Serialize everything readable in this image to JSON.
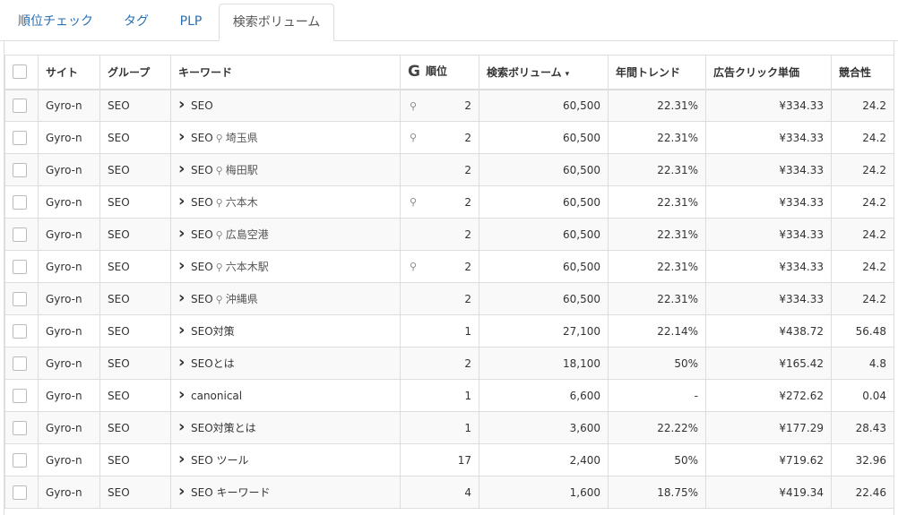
{
  "tabs": [
    {
      "label": "順位チェック",
      "active": false
    },
    {
      "label": "タグ",
      "active": false
    },
    {
      "label": "PLP",
      "active": false
    },
    {
      "label": "検索ボリューム",
      "active": true
    }
  ],
  "table": {
    "headers": {
      "site": "サイト",
      "group": "グループ",
      "keyword": "キーワード",
      "rank_icon": "G",
      "rank": "順位",
      "volume": "検索ボリューム",
      "trend": "年間トレンド",
      "cpc": "広告クリック単価",
      "competition": "競合性"
    },
    "sort_indicator": "▾",
    "rows": [
      {
        "site": "Gyro-n",
        "group": "SEO",
        "keyword": "SEO",
        "location": "",
        "rank_pin": true,
        "rank": "2",
        "volume": "60,500",
        "trend": "22.31%",
        "cpc": "¥334.33",
        "competition": "24.2"
      },
      {
        "site": "Gyro-n",
        "group": "SEO",
        "keyword": "SEO",
        "location": "埼玉県",
        "rank_pin": true,
        "rank": "2",
        "volume": "60,500",
        "trend": "22.31%",
        "cpc": "¥334.33",
        "competition": "24.2"
      },
      {
        "site": "Gyro-n",
        "group": "SEO",
        "keyword": "SEO",
        "location": "梅田駅",
        "rank_pin": false,
        "rank": "2",
        "volume": "60,500",
        "trend": "22.31%",
        "cpc": "¥334.33",
        "competition": "24.2"
      },
      {
        "site": "Gyro-n",
        "group": "SEO",
        "keyword": "SEO",
        "location": "六本木",
        "rank_pin": true,
        "rank": "2",
        "volume": "60,500",
        "trend": "22.31%",
        "cpc": "¥334.33",
        "competition": "24.2"
      },
      {
        "site": "Gyro-n",
        "group": "SEO",
        "keyword": "SEO",
        "location": "広島空港",
        "rank_pin": false,
        "rank": "2",
        "volume": "60,500",
        "trend": "22.31%",
        "cpc": "¥334.33",
        "competition": "24.2"
      },
      {
        "site": "Gyro-n",
        "group": "SEO",
        "keyword": "SEO",
        "location": "六本木駅",
        "rank_pin": true,
        "rank": "2",
        "volume": "60,500",
        "trend": "22.31%",
        "cpc": "¥334.33",
        "competition": "24.2"
      },
      {
        "site": "Gyro-n",
        "group": "SEO",
        "keyword": "SEO",
        "location": "沖縄県",
        "rank_pin": false,
        "rank": "2",
        "volume": "60,500",
        "trend": "22.31%",
        "cpc": "¥334.33",
        "competition": "24.2"
      },
      {
        "site": "Gyro-n",
        "group": "SEO",
        "keyword": "SEO対策",
        "location": "",
        "rank_pin": false,
        "rank": "1",
        "volume": "27,100",
        "trend": "22.14%",
        "cpc": "¥438.72",
        "competition": "56.48"
      },
      {
        "site": "Gyro-n",
        "group": "SEO",
        "keyword": "SEOとは",
        "location": "",
        "rank_pin": false,
        "rank": "2",
        "volume": "18,100",
        "trend": "50%",
        "cpc": "¥165.42",
        "competition": "4.8"
      },
      {
        "site": "Gyro-n",
        "group": "SEO",
        "keyword": "canonical",
        "location": "",
        "rank_pin": false,
        "rank": "1",
        "volume": "6,600",
        "trend": "-",
        "cpc": "¥272.62",
        "competition": "0.04"
      },
      {
        "site": "Gyro-n",
        "group": "SEO",
        "keyword": "SEO対策とは",
        "location": "",
        "rank_pin": false,
        "rank": "1",
        "volume": "3,600",
        "trend": "22.22%",
        "cpc": "¥177.29",
        "competition": "28.43"
      },
      {
        "site": "Gyro-n",
        "group": "SEO",
        "keyword": "SEO ツール",
        "location": "",
        "rank_pin": false,
        "rank": "17",
        "volume": "2,400",
        "trend": "50%",
        "cpc": "¥719.62",
        "competition": "32.96"
      },
      {
        "site": "Gyro-n",
        "group": "SEO",
        "keyword": "SEO キーワード",
        "location": "",
        "rank_pin": false,
        "rank": "4",
        "volume": "1,600",
        "trend": "18.75%",
        "cpc": "¥419.34",
        "competition": "22.46"
      }
    ]
  }
}
